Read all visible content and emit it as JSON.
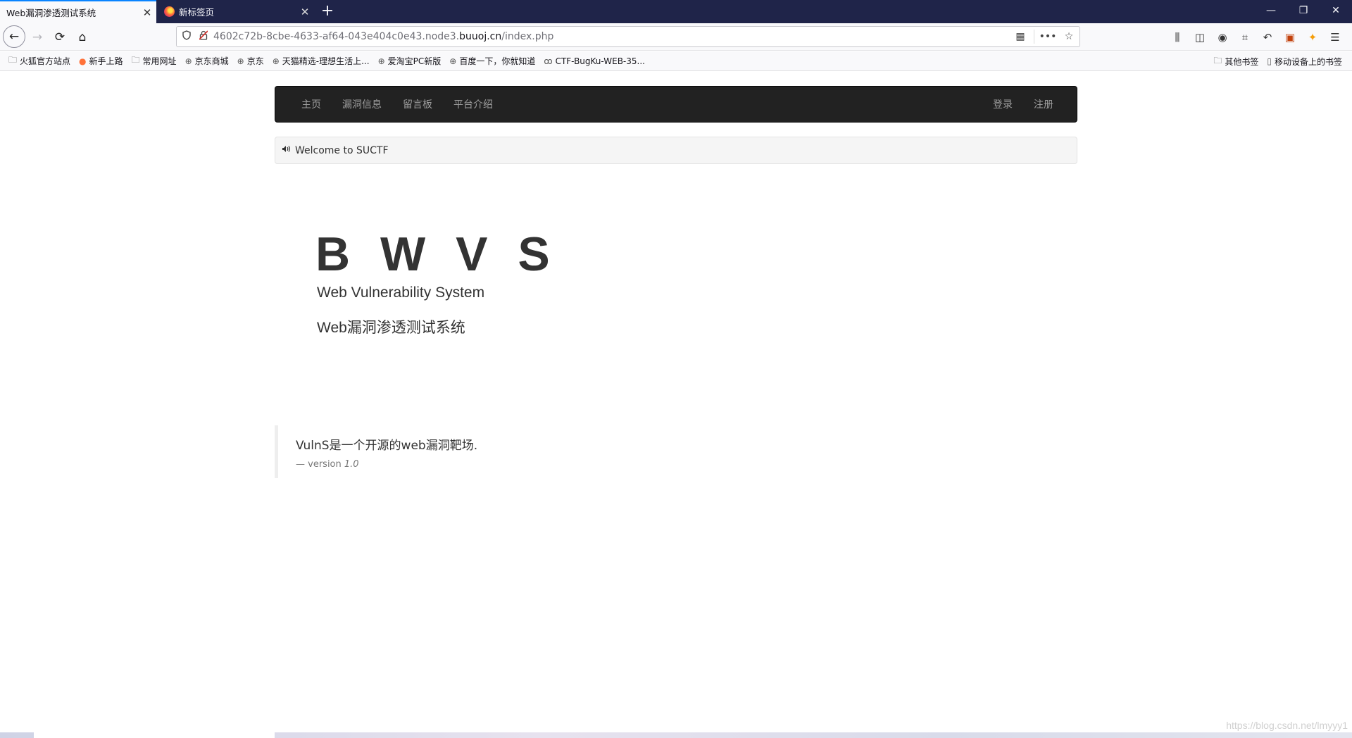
{
  "browser": {
    "tabs": [
      {
        "title": "Web漏洞渗透测试系统",
        "close": "✕"
      },
      {
        "title": "新标签页",
        "close": "✕"
      }
    ],
    "new_tab": "+",
    "window": {
      "minimize": "—",
      "restore": "❐",
      "close": "✕"
    },
    "nav": {
      "back": "←",
      "forward": "→",
      "reload": "⟳",
      "home": "⌂"
    },
    "url": {
      "prefix": "4602c72b-8cbe-4633-af64-043e404c0e43.node3.",
      "domain": "buuoj.cn",
      "path": "/index.php"
    },
    "url_icons": {
      "qr": "▦",
      "more": "•••",
      "star": "☆"
    },
    "toolbar_icons": [
      "library-icon",
      "sidebar-icon",
      "account-icon",
      "screenshot-icon",
      "undo-icon",
      "extension-icon",
      "addon-icon",
      "menu-icon"
    ],
    "toolbar_glyphs": [
      "⫼",
      "◫",
      "◉",
      "⌗",
      "↶",
      "▣",
      "✦",
      "☰"
    ],
    "bookmarks": [
      {
        "label": "火狐官方站点",
        "icon": "folder"
      },
      {
        "label": "新手上路",
        "icon": "firefox"
      },
      {
        "label": "常用网址",
        "icon": "folder"
      },
      {
        "label": "京东商城",
        "icon": "globe"
      },
      {
        "label": "京东",
        "icon": "globe"
      },
      {
        "label": "天猫精选-理想生活上...",
        "icon": "globe"
      },
      {
        "label": "爱淘宝PC新版",
        "icon": "globe"
      },
      {
        "label": "百度一下，你就知道",
        "icon": "globe"
      },
      {
        "label": "CTF-BugKu-WEB-35...",
        "icon": "bug"
      }
    ],
    "bookmarks_right": [
      {
        "label": "其他书签",
        "icon": "folder"
      },
      {
        "label": "移动设备上的书签",
        "icon": "mobile"
      }
    ]
  },
  "site": {
    "nav_left": [
      "主页",
      "漏洞信息",
      "留言板",
      "平台介绍"
    ],
    "nav_right": [
      "登录",
      "注册"
    ],
    "notice": "Welcome to SUCTF",
    "brand": "B W V S",
    "subtitle_en": "Web Vulnerability System",
    "subtitle_cn": "Web漏洞渗透测试系统",
    "quote": "VulnS是一个开源的web漏洞靶场.",
    "quote_footer_prefix": "— version",
    "quote_footer_version": "1.0"
  },
  "watermark": "https://blog.csdn.net/lmyyy1"
}
